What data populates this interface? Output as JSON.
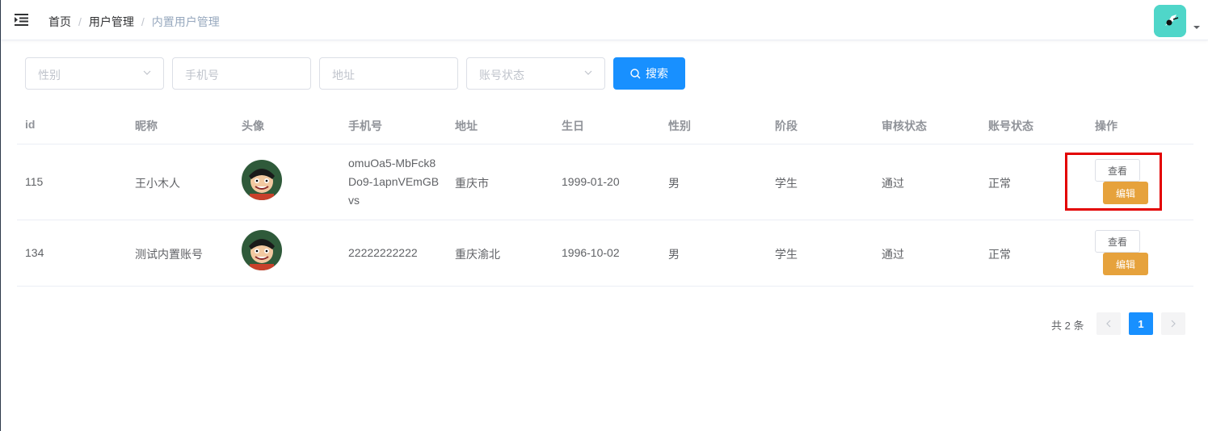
{
  "breadcrumb": [
    "首页",
    "用户管理",
    "内置用户管理"
  ],
  "breadcrumb_separator": "/",
  "filters": {
    "gender_placeholder": "性别",
    "phone_placeholder": "手机号",
    "address_placeholder": "地址",
    "account_status_placeholder": "账号状态",
    "search_label": "搜索"
  },
  "table": {
    "columns": [
      "id",
      "昵称",
      "头像",
      "手机号",
      "地址",
      "生日",
      "性别",
      "阶段",
      "审核状态",
      "账号状态",
      "操作"
    ],
    "rows": [
      {
        "id": "115",
        "nickname": "王小木人",
        "phone": "omuOa5-MbFck8Do9-1apnVEmGBvs",
        "address": "重庆市",
        "birthday": "1999-01-20",
        "gender": "男",
        "stage": "学生",
        "review": "通过",
        "status": "正常",
        "view": "查看",
        "edit": "编辑"
      },
      {
        "id": "134",
        "nickname": "测试内置账号",
        "phone": "22222222222",
        "address": "重庆渝北",
        "birthday": "1996-10-02",
        "gender": "男",
        "stage": "学生",
        "review": "通过",
        "status": "正常",
        "view": "查看",
        "edit": "编辑"
      }
    ]
  },
  "pagination": {
    "total": "共 2 条",
    "current": "1"
  },
  "colors": {
    "primary": "#1890ff",
    "warning": "#e6a23c",
    "highlight": "#e30000",
    "avatar_bg": "#4fd6c9"
  }
}
